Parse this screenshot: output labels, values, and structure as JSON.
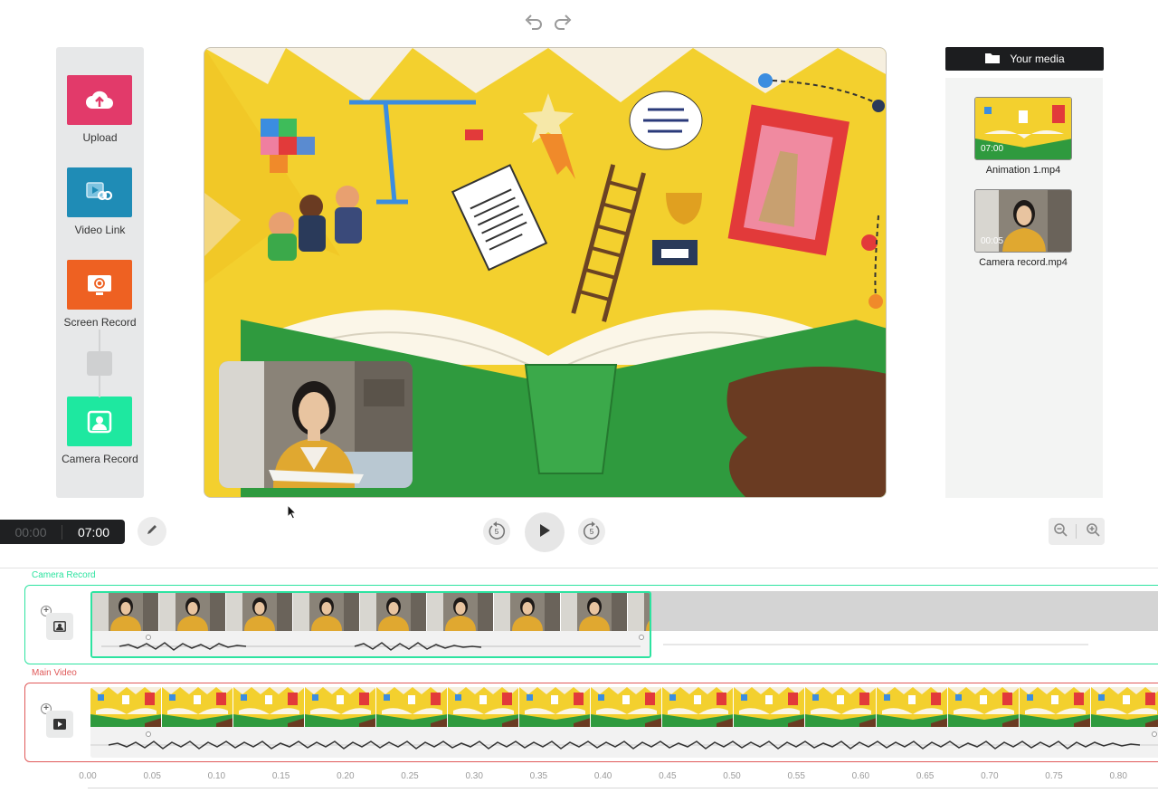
{
  "toolbar": {
    "undo_icon": "undo-icon",
    "redo_icon": "redo-icon"
  },
  "tools": [
    {
      "label": "Upload",
      "icon": "cloud-upload-icon",
      "color": "#e23a6a"
    },
    {
      "label": "Video Link",
      "icon": "video-link-icon",
      "color": "#1f8cb6"
    },
    {
      "label": "Screen Record",
      "icon": "screen-record-icon",
      "color": "#ee6122"
    },
    {
      "label": "Camera Record",
      "icon": "camera-record-icon",
      "color": "#1ee8a0"
    }
  ],
  "media": {
    "header": "Your media",
    "items": [
      {
        "name": "Animation 1.mp4",
        "duration": "07:00"
      },
      {
        "name": "Camera record.mp4",
        "duration": "00:05"
      }
    ]
  },
  "transport": {
    "current_time": "00:00",
    "total_time": "07:00",
    "rewind_label": "5",
    "forward_label": "5"
  },
  "tracks": [
    {
      "name": "Camera Record",
      "color": "#2de3a0",
      "selected_fraction": 0.5
    },
    {
      "name": "Main Video",
      "color": "#e05a5a"
    }
  ],
  "ruler": [
    "0.00",
    "0.05",
    "0.10",
    "0.15",
    "0.20",
    "0.25",
    "0.30",
    "0.35",
    "0.40",
    "0.45",
    "0.50",
    "0.55",
    "0.60",
    "0.65",
    "0.70",
    "0.75",
    "0.80"
  ],
  "colors": {
    "accent_green": "#2de3a0",
    "accent_red": "#e05a5a",
    "dark": "#1f2022"
  }
}
